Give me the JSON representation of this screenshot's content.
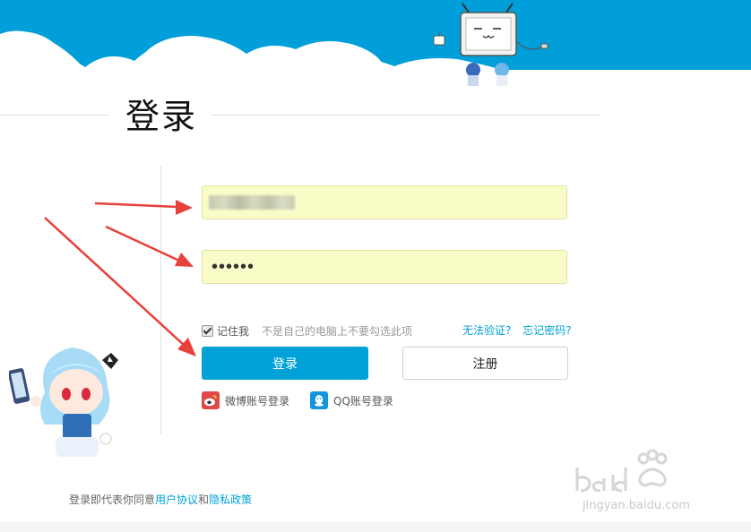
{
  "title": "登录",
  "form": {
    "username_value": "",
    "password_value": "••••••",
    "remember_label": "记住我",
    "remember_checked": true,
    "remember_hint": "不是自己的电脑上不要勾选此项",
    "cannot_verify_link": "无法验证?",
    "forgot_password_link": "忘记密码?",
    "login_button": "登录",
    "register_button": "注册"
  },
  "social": {
    "weibo_label": "微博账号登录",
    "qq_label": "QQ账号登录"
  },
  "footer": {
    "prefix": "登录即代表你同意",
    "user_agreement": "用户协议",
    "and": "和",
    "privacy_policy": "隐私政策"
  },
  "watermark": {
    "text": "jingyan.baidu.com"
  },
  "colors": {
    "accent": "#00a1d6",
    "banner": "#009fd9",
    "field_bg": "#fafcc8",
    "arrow": "#e8403a"
  }
}
